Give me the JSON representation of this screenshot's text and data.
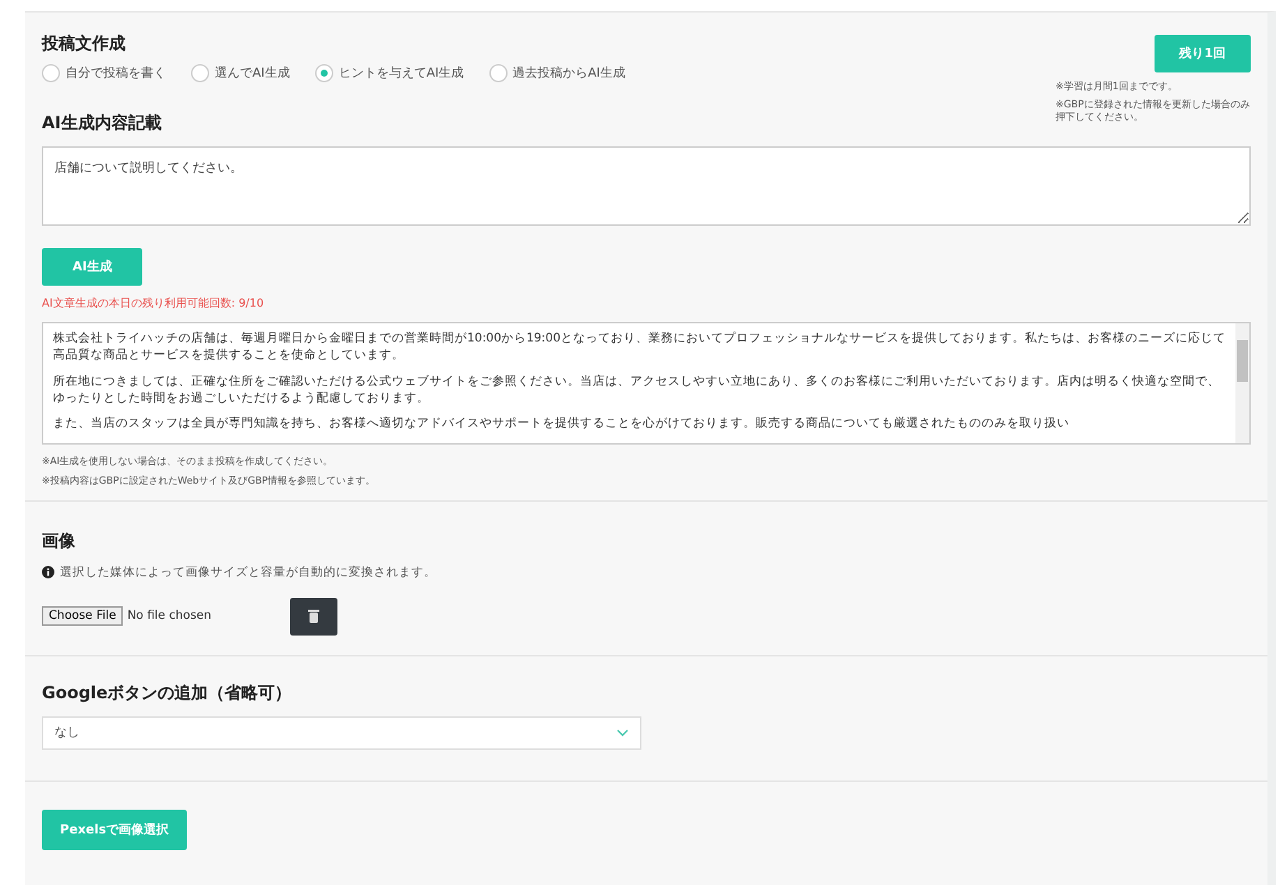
{
  "post_composer": {
    "title": "投稿文作成",
    "modes": [
      {
        "label": "自分で投稿を書く",
        "selected": false
      },
      {
        "label": "選んでAI生成",
        "selected": false
      },
      {
        "label": "ヒントを与えてAI生成",
        "selected": true
      },
      {
        "label": "過去投稿からAI生成",
        "selected": false
      }
    ],
    "remaining_button": "残り1回",
    "notes": [
      "※学習は月間1回までです。",
      "※GBPに登録された情報を更新した場合のみ押下してください。"
    ]
  },
  "ai_prompt": {
    "title": "AI生成内容記載",
    "value": "店舗について説明してください。",
    "generate_button": "AI生成",
    "usage_notice": "AI文章生成の本日の残り利用可能回数: 9/10"
  },
  "generated_text": {
    "paragraphs": [
      "株式会社トライハッチの店舗は、毎週月曜日から金曜日までの営業時間が10:00から19:00となっており、業務においてプロフェッショナルなサービスを提供しております。私たちは、お客様のニーズに応じて高品質な商品とサービスを提供することを使命としています。",
      "所在地につきましては、正確な住所をご確認いただける公式ウェブサイトをご参照ください。当店は、アクセスしやすい立地にあり、多くのお客様にご利用いただいております。店内は明るく快適な空間で、ゆったりとした時間をお過ごしいただけるよう配慮しております。",
      "また、当店のスタッフは全員が専門知識を持ち、お客様へ適切なアドバイスやサポートを提供することを心がけております。販売する商品についても厳選されたもののみを取り扱い"
    ],
    "notes": [
      "※AI生成を使用しない場合は、そのまま投稿を作成してください。",
      "※投稿内容はGBPに設定されたWebサイト及びGBP情報を参照しています。"
    ]
  },
  "image": {
    "title": "画像",
    "info": "選択した媒体によって画像サイズと容量が自動的に変換されます。",
    "file_button": "Choose File",
    "file_status": "No file chosen"
  },
  "google_button": {
    "title": "Googleボタンの追加（省略可）",
    "value": "なし"
  },
  "pexels_button": "Pexelsで画像選択"
}
